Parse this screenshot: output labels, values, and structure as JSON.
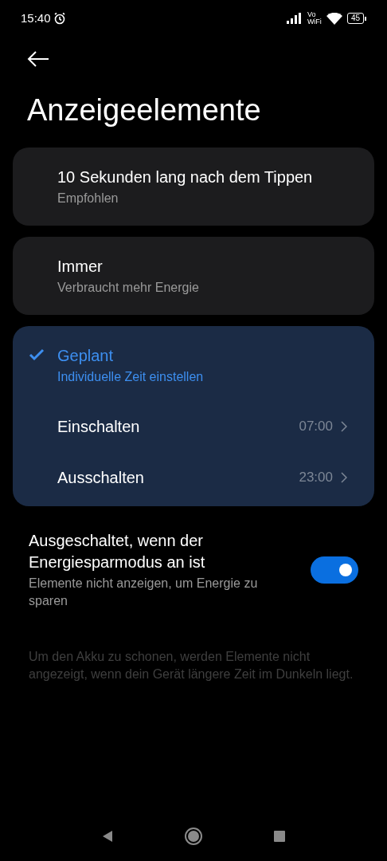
{
  "status_bar": {
    "time": "15:40",
    "network_top": "Vo",
    "network_bottom": "WiFi",
    "battery": "45"
  },
  "title": "Anzeigeelemente",
  "options": [
    {
      "title": "10 Sekunden lang nach dem Tippen",
      "subtitle": "Empfohlen",
      "selected": false
    },
    {
      "title": "Immer",
      "subtitle": "Verbraucht mehr Energie",
      "selected": false
    },
    {
      "title": "Geplant",
      "subtitle": "Individuelle Zeit einstellen",
      "selected": true,
      "rows": [
        {
          "label": "Einschalten",
          "value": "07:00"
        },
        {
          "label": "Ausschalten",
          "value": "23:00"
        }
      ]
    }
  ],
  "power_saving": {
    "title": "Ausgeschaltet, wenn der Energiesparmodus an ist",
    "subtitle": "Elemente nicht anzeigen, um Energie zu sparen",
    "on": true
  },
  "footnote": "Um den Akku zu schonen, werden Elemente nicht angezeigt, wenn dein Gerät längere Zeit im Dunkeln liegt."
}
